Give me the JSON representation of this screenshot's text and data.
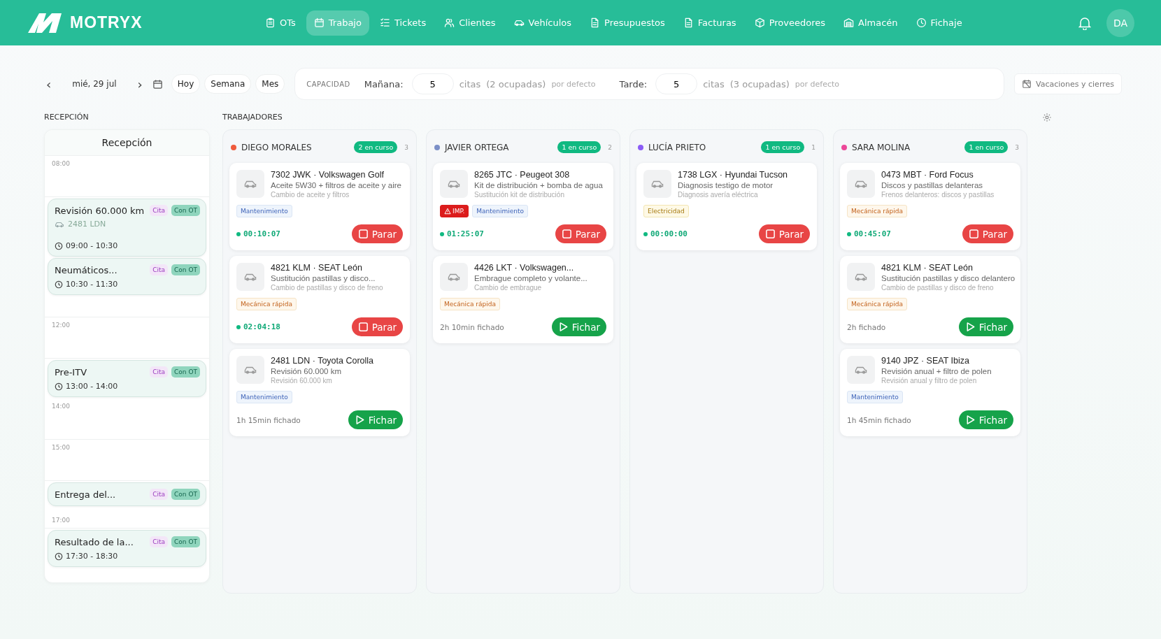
{
  "brand": "MOTRYX",
  "nav": [
    {
      "label": "OTs",
      "selected": false
    },
    {
      "label": "Trabajo",
      "selected": true
    },
    {
      "label": "Tickets",
      "selected": false
    },
    {
      "label": "Clientes",
      "selected": false
    },
    {
      "label": "Vehículos",
      "selected": false
    },
    {
      "label": "Presupuestos",
      "selected": false
    },
    {
      "label": "Facturas",
      "selected": false
    },
    {
      "label": "Proveedores",
      "selected": false
    },
    {
      "label": "Almacén",
      "selected": false
    },
    {
      "label": "Fichaje",
      "selected": false
    }
  ],
  "user_initials": "DA",
  "toolbar": {
    "prev": "‹",
    "date": "mié, 29 jul",
    "next": "›",
    "views": [
      "Hoy",
      "Semana",
      "Mes"
    ]
  },
  "capacity": {
    "label": "CAPACIDAD",
    "shifts": [
      {
        "label": "Mañana:",
        "value": "5",
        "unit": "citas",
        "occupied": "(2 ocupadas)",
        "note": "por defecto"
      },
      {
        "label": "Tarde:",
        "value": "5",
        "unit": "citas",
        "occupied": "(3 ocupadas)",
        "note": "por defecto"
      }
    ]
  },
  "closures_button": "Vacaciones y cierres",
  "reception": {
    "section_label": "RECEPCIÓN",
    "title": "Recepción",
    "items": [
      {
        "kind": "hour",
        "label": "08:00"
      },
      {
        "kind": "appointment",
        "title": "Revisión 60.000 km",
        "plate": "2481 LDN",
        "time": "09:00 - 10:30",
        "badges": [
          "Cita",
          "Con OT"
        ]
      },
      {
        "kind": "appointment",
        "title": "Neumáticos...",
        "time": "10:30 - 11:30",
        "badges": [
          "Cita",
          "Con OT"
        ]
      },
      {
        "kind": "gap"
      },
      {
        "kind": "hour",
        "label": "12:00"
      },
      {
        "kind": "appointment",
        "title": "Pre-ITV",
        "time": "13:00 - 14:00",
        "badges": [
          "Cita",
          "Con OT"
        ]
      },
      {
        "kind": "hour",
        "label": "14:00"
      },
      {
        "kind": "hour",
        "label": "15:00"
      },
      {
        "kind": "appointment",
        "title": "Entrega del...",
        "badges": [
          "Cita",
          "Con OT"
        ]
      },
      {
        "kind": "halfhour",
        "label": "17:00"
      },
      {
        "kind": "appointment",
        "title": "Resultado de la...",
        "time": "17:30 - 18:30",
        "badges": [
          "Cita",
          "Con OT"
        ]
      }
    ]
  },
  "workers_label": "TRABAJADORES",
  "workers": [
    {
      "name": "DIEGO MORALES",
      "color": "#ef5a3c",
      "active": "2 en curso",
      "count": "3",
      "jobs": [
        {
          "title": "7302 JWK · Volkswagen Golf",
          "desc": "Aceite 5W30 + filtros de aceite y aire",
          "sub": "Cambio de aceite y filtros",
          "tags": [
            {
              "label": "Mantenimiento",
              "kind": "maintenance"
            }
          ],
          "kind": "running",
          "status": "00:10:07",
          "button": "Parar"
        },
        {
          "title": "4821 KLM · SEAT León",
          "desc": "Sustitución pastillas y disco...",
          "sub": "Cambio de pastillas y disco de freno",
          "tags": [
            {
              "label": "Mecánica rápida",
              "kind": "quick"
            }
          ],
          "kind": "running",
          "status": "02:04:18",
          "button": "Parar"
        },
        {
          "title": "2481 LDN · Toyota Corolla",
          "desc": "Revisión 60.000 km",
          "sub": "Revisión 60.000 km",
          "tags": [
            {
              "label": "Mantenimiento",
              "kind": "maintenance"
            }
          ],
          "kind": "idle",
          "status": "1h 15min fichado",
          "button": "Fichar"
        }
      ]
    },
    {
      "name": "JAVIER ORTEGA",
      "color": "#7b8fc7",
      "active": "1 en curso",
      "count": "2",
      "jobs": [
        {
          "title": "8265 JTC · Peugeot 308",
          "desc": "Kit de distribución + bomba de agua",
          "sub": "Sustitución kit de distribución",
          "tags": [
            {
              "label": "IMP.",
              "kind": "important"
            },
            {
              "label": "Mantenimiento",
              "kind": "maintenance"
            }
          ],
          "kind": "running",
          "status": "01:25:07",
          "button": "Parar"
        },
        {
          "title": "4426 LKT · Volkswagen...",
          "desc": "Embrague completo y volante...",
          "sub": "Cambio de embrague",
          "tags": [
            {
              "label": "Mecánica rápida",
              "kind": "quick"
            }
          ],
          "kind": "idle",
          "status": "2h 10min fichado",
          "button": "Fichar"
        }
      ]
    },
    {
      "name": "LUCÍA PRIETO",
      "color": "#8b5cf6",
      "active": "1 en curso",
      "count": "1",
      "jobs": [
        {
          "title": "1738 LGX · Hyundai Tucson",
          "desc": "Diagnosis testigo de motor",
          "sub": "Diagnosis avería eléctrica",
          "tags": [
            {
              "label": "Electricidad",
              "kind": "electric"
            }
          ],
          "kind": "running",
          "status": "00:00:00",
          "button": "Parar"
        }
      ]
    },
    {
      "name": "SARA MOLINA",
      "color": "#ec4899",
      "active": "1 en curso",
      "count": "3",
      "jobs": [
        {
          "title": "0473 MBT · Ford Focus",
          "desc": "Discos y pastillas delanteras",
          "sub": "Frenos delanteros: discos y pastillas",
          "tags": [
            {
              "label": "Mecánica rápida",
              "kind": "quick"
            }
          ],
          "kind": "running",
          "status": "00:45:07",
          "button": "Parar"
        },
        {
          "title": "4821 KLM · SEAT León",
          "desc": "Sustitución pastillas y disco delantero",
          "sub": "Cambio de pastillas y disco de freno",
          "tags": [
            {
              "label": "Mecánica rápida",
              "kind": "quick"
            }
          ],
          "kind": "idle",
          "status": "2h fichado",
          "button": "Fichar"
        },
        {
          "title": "9140 JPZ · SEAT Ibiza",
          "desc": "Revisión anual + filtro de polen",
          "sub": "Revisión anual y filtro de polen",
          "tags": [
            {
              "label": "Mantenimiento",
              "kind": "maintenance"
            }
          ],
          "kind": "idle",
          "status": "1h 45min fichado",
          "button": "Fichar"
        }
      ]
    }
  ]
}
